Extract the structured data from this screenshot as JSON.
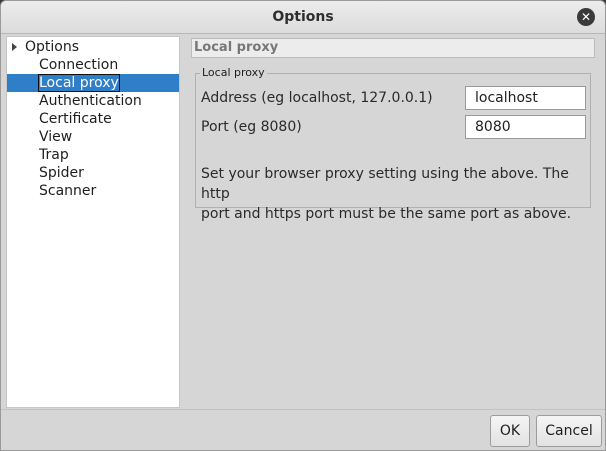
{
  "window": {
    "title": "Options",
    "close_icon": "close-icon"
  },
  "sidebar": {
    "root_label": "Options",
    "items": [
      {
        "label": "Connection",
        "selected": false
      },
      {
        "label": "Local proxy",
        "selected": true
      },
      {
        "label": "Authentication",
        "selected": false
      },
      {
        "label": "Certificate",
        "selected": false
      },
      {
        "label": "View",
        "selected": false
      },
      {
        "label": "Trap",
        "selected": false
      },
      {
        "label": "Spider",
        "selected": false
      },
      {
        "label": "Scanner",
        "selected": false
      }
    ]
  },
  "panel": {
    "header": "Local proxy",
    "group_title": "Local proxy",
    "address_label": "Address (eg localhost, 127.0.0.1)",
    "address_value": "localhost",
    "port_label": "Port (eg 8080)",
    "port_value": "8080",
    "info_line1": "Set your browser proxy setting using the above. The http",
    "info_line2": "port and https port must be the same port as above."
  },
  "buttons": {
    "ok": "OK",
    "cancel": "Cancel"
  },
  "colors": {
    "selection": "#2e7ec8",
    "dialog_bg": "#d6d6d6"
  }
}
